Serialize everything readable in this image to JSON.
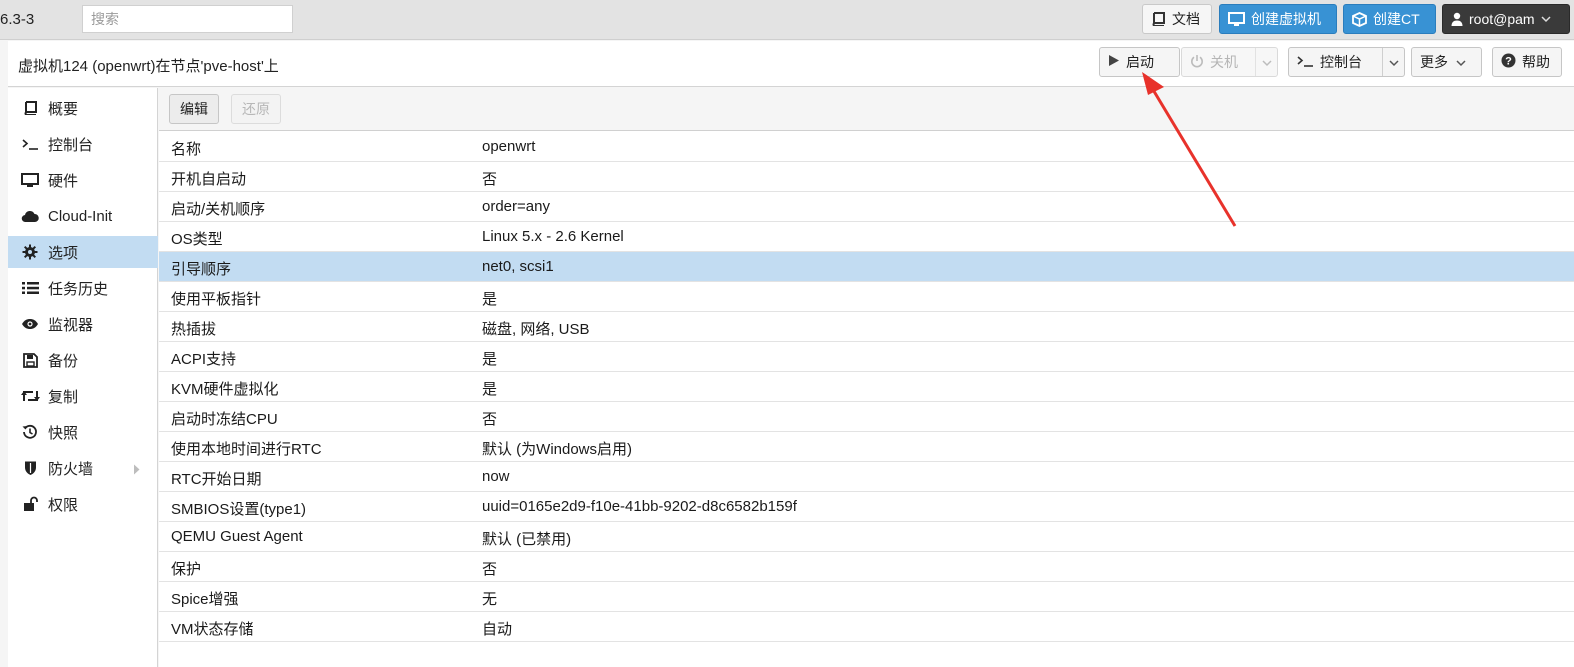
{
  "topbar": {
    "version": "6.3-3",
    "search_placeholder": "搜索",
    "docs_label": "文档",
    "create_vm_label": "创建虚拟机",
    "create_ct_label": "创建CT",
    "user_label": "root@pam"
  },
  "header": {
    "title": "虚拟机124 (openwrt)在节点'pve-host'上",
    "start_label": "启动",
    "shutdown_label": "关机",
    "console_label": "控制台",
    "more_label": "更多",
    "help_label": "帮助"
  },
  "nav": {
    "items": [
      {
        "label": "概要",
        "icon": "book-icon"
      },
      {
        "label": "控制台",
        "icon": "terminal-icon"
      },
      {
        "label": "硬件",
        "icon": "monitor-icon"
      },
      {
        "label": "Cloud-Init",
        "icon": "cloud-icon"
      },
      {
        "label": "选项",
        "icon": "gear-icon",
        "active": true
      },
      {
        "label": "任务历史",
        "icon": "list-icon"
      },
      {
        "label": "监视器",
        "icon": "eye-icon"
      },
      {
        "label": "备份",
        "icon": "floppy-icon"
      },
      {
        "label": "复制",
        "icon": "retweet-icon"
      },
      {
        "label": "快照",
        "icon": "history-icon"
      },
      {
        "label": "防火墙",
        "icon": "shield-icon",
        "expandable": true
      },
      {
        "label": "权限",
        "icon": "unlock-icon"
      }
    ]
  },
  "toolbar": {
    "edit_label": "编辑",
    "revert_label": "还原"
  },
  "options": {
    "rows": [
      {
        "key": "名称",
        "value": "openwrt"
      },
      {
        "key": "开机自启动",
        "value": "否"
      },
      {
        "key": "启动/关机顺序",
        "value": "order=any"
      },
      {
        "key": "OS类型",
        "value": "Linux 5.x - 2.6 Kernel"
      },
      {
        "key": "引导顺序",
        "value": "net0, scsi1",
        "selected": true
      },
      {
        "key": "使用平板指针",
        "value": "是"
      },
      {
        "key": "热插拔",
        "value": "磁盘, 网络, USB"
      },
      {
        "key": "ACPI支持",
        "value": "是"
      },
      {
        "key": "KVM硬件虚拟化",
        "value": "是"
      },
      {
        "key": "启动时冻结CPU",
        "value": "否"
      },
      {
        "key": "使用本地时间进行RTC",
        "value": "默认 (为Windows启用)"
      },
      {
        "key": "RTC开始日期",
        "value": "now"
      },
      {
        "key": "SMBIOS设置(type1)",
        "value": "uuid=0165e2d9-f10e-41bb-9202-d8c6582b159f"
      },
      {
        "key": "QEMU Guest Agent",
        "value": "默认 (已禁用)"
      },
      {
        "key": "保护",
        "value": "否"
      },
      {
        "key": "Spice增强",
        "value": "无"
      },
      {
        "key": "VM状态存储",
        "value": "自动"
      }
    ]
  },
  "colors": {
    "selection": "#c2dcf2",
    "accent_blue": "#3892d4",
    "annotation_arrow": "#e8322b"
  }
}
